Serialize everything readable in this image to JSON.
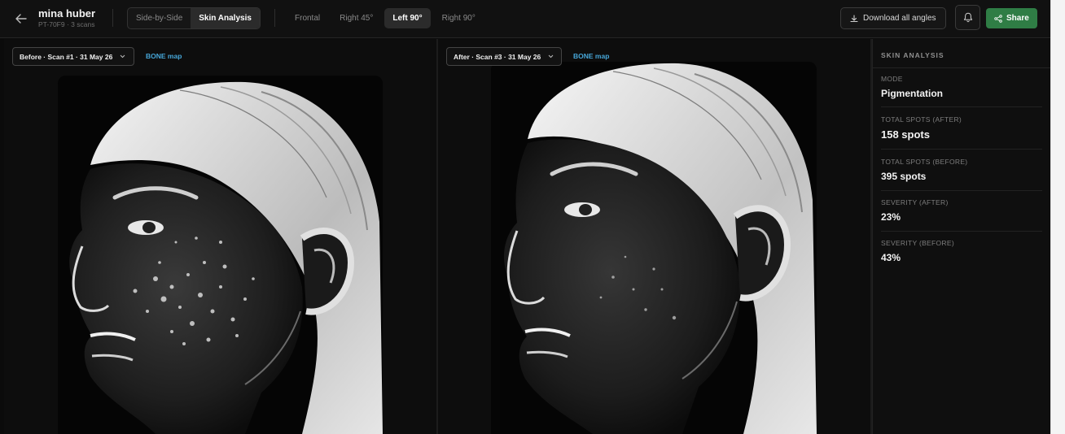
{
  "header": {
    "patient_name": "mina huber",
    "patient_meta": "PT-70F9 · 3 scans",
    "modes": [
      {
        "label": "Side-by-Side",
        "active": false
      },
      {
        "label": "Skin Analysis",
        "active": true
      }
    ],
    "angles": [
      {
        "label": "Frontal",
        "active": false
      },
      {
        "label": "Right 45°",
        "active": false
      },
      {
        "label": "Left 90°",
        "active": true
      },
      {
        "label": "Right 90°",
        "active": false
      }
    ],
    "download_label": "Download all angles",
    "share_label": "Share",
    "icons": {
      "back": "arrow-left-icon",
      "download": "download-icon",
      "bell": "bell-icon",
      "share": "share-icon"
    }
  },
  "panels": {
    "before": {
      "scan_label": "Before · Scan #1 · 31 May 26",
      "map_label": "BONE map",
      "image": "before-face-left-profile"
    },
    "after": {
      "scan_label": "After · Scan #3 · 31 May 26",
      "map_label": "BONE map",
      "image": "after-face-left-profile"
    }
  },
  "sidebar": {
    "title": "SKIN ANALYSIS",
    "metrics": [
      {
        "label": "MODE",
        "value": "Pigmentation"
      },
      {
        "label": "TOTAL SPOTS (AFTER)",
        "value": "158 spots"
      },
      {
        "label": "TOTAL SPOTS (BEFORE)",
        "value": "395 spots"
      },
      {
        "label": "SEVERITY (AFTER)",
        "value": "23%"
      },
      {
        "label": "SEVERITY (BEFORE)",
        "value": "43%"
      }
    ]
  },
  "colors": {
    "accent_green": "#2f7d45",
    "link_blue": "#46a6d8",
    "background": "#0b0b0b"
  }
}
